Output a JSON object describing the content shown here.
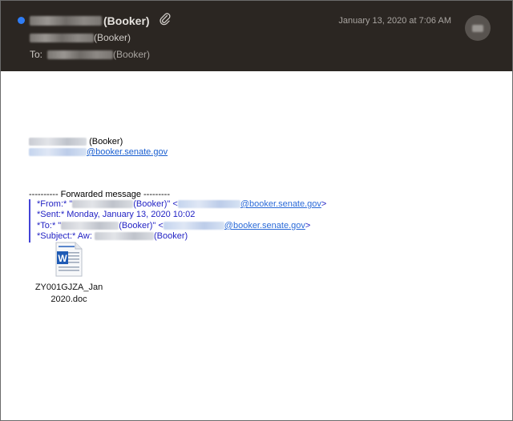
{
  "header": {
    "sender_suffix": "(Booker)",
    "date": "January 13, 2020 at 7:06 AM",
    "from_suffix": "(Booker)",
    "to_label": "To:",
    "to_suffix": "(Booker)",
    "unread_color": "#2f7df6",
    "attachment_icon": "paperclip-icon",
    "avatar_icon": "avatar"
  },
  "body": {
    "signature_name_suffix": "(Booker)",
    "signature_email_domain": "@booker.senate.gov",
    "forward_header": "---------- Forwarded message ---------",
    "quoted": {
      "from_label": "*From:*",
      "from_open": " \"",
      "from_name_suffix": "(Booker)\" <",
      "from_email_domain": "@booker.senate.gov",
      "from_close": ">",
      "sent_label": "*Sent:*",
      "sent_value": " Monday, January 13, 2020 10:02",
      "to_label": "*To:*",
      "to_open": " \"",
      "to_name_suffix": "(Booker)\" <",
      "to_email_domain": "@booker.senate.gov",
      "to_close": ">",
      "subject_label": "*Subject:*",
      "subject_prefix": " Aw: ",
      "subject_suffix": "(Booker)"
    },
    "attachment": {
      "name_line1": "ZY001GJZA_Jan",
      "name_line2": "2020.doc",
      "icon": "word-document-icon"
    }
  }
}
